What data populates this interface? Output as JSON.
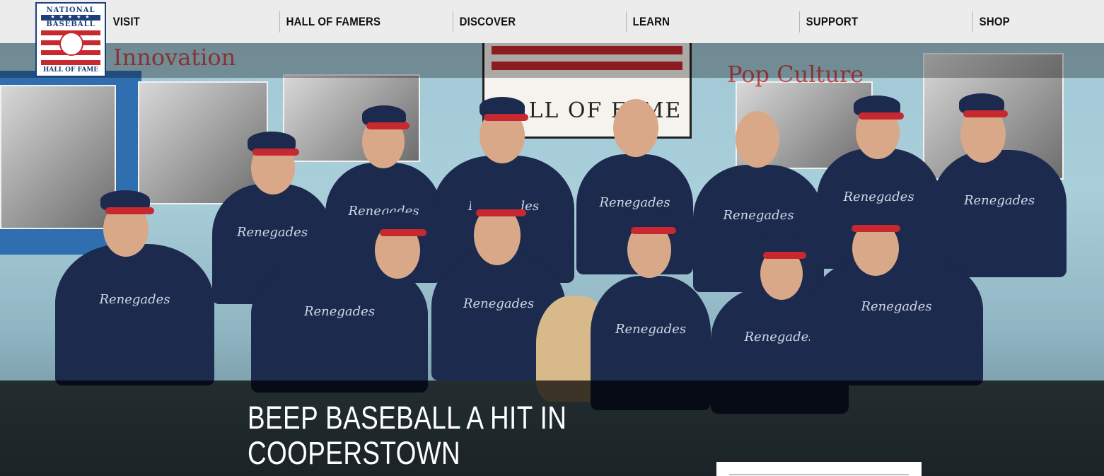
{
  "logo": {
    "line1": "NATIONAL",
    "line2": "BASEBALL",
    "line3": "HALL OF FAME",
    "stars": "★ ★ ★ ★ ★"
  },
  "nav": {
    "items": [
      {
        "label": "VISIT"
      },
      {
        "label": "HALL OF FAMERS"
      },
      {
        "label": "DISCOVER"
      },
      {
        "label": "LEARN"
      },
      {
        "label": "SUPPORT"
      },
      {
        "label": "SHOP"
      }
    ]
  },
  "hero": {
    "headline_line1": "BEEP BASEBALL A HIT IN",
    "headline_line2": "COOPERSTOWN",
    "wall_sign": "HALL OF FAME",
    "wall_text_1": "Innovation",
    "wall_text_2": "Pop Culture",
    "jersey_text": "Renegades"
  },
  "colors": {
    "nav_bg": "#ececec",
    "brand_red": "#c8282f",
    "brand_navy": "#1d3f7a"
  }
}
